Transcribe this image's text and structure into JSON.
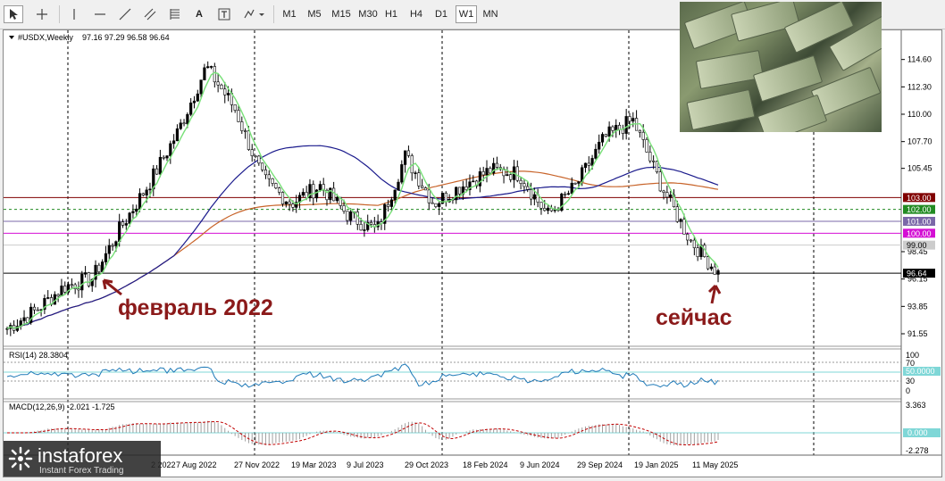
{
  "toolbar": {
    "tools": [
      "cursor-icon",
      "crosshair-icon",
      "vertical-line-icon",
      "horizontal-line-icon",
      "trend-line-icon",
      "fibonacci-icon",
      "text-label-icon",
      "text-tool-icon",
      "shapes-icon"
    ],
    "text_tool_label": "A",
    "timeframes": [
      "M1",
      "M5",
      "M15",
      "M30",
      "H1",
      "H4",
      "D1",
      "W1",
      "MN"
    ],
    "active_timeframe": "W1"
  },
  "header": {
    "symbol": "#USDX,Weekly",
    "ohlc": "97.16 97.29 96.58 96.64"
  },
  "annotations": {
    "feb2022": "февраль 2022",
    "now": "сейчас"
  },
  "price_axis": {
    "ticks": [
      "114.60",
      "112.30",
      "110.00",
      "107.70",
      "105.45",
      "98.45",
      "96.15",
      "93.85",
      "91.55"
    ]
  },
  "price_labels": [
    {
      "text": "103.00",
      "value": 103.0,
      "color": "#800000"
    },
    {
      "text": "102.00",
      "value": 102.0,
      "color": "#228b22"
    },
    {
      "text": "101.00",
      "value": 101.0,
      "color": "#7b68a8"
    },
    {
      "text": "100.00",
      "value": 100.0,
      "color": "#d40fd4"
    },
    {
      "text": "99.00",
      "value": 99.0,
      "color": "#cccccc"
    },
    {
      "text": "96.64",
      "value": 96.64,
      "color": "#000000"
    }
  ],
  "time_axis": {
    "labels": [
      "2 2022",
      "7 Aug 2022",
      "27 Nov 2022",
      "19 Mar 2023",
      "9 Jul 2023",
      "29 Oct 2023",
      "18 Feb 2024",
      "9 Jun 2024",
      "29 Sep 2024",
      "19 Jan 2025",
      "11 May 2025"
    ]
  },
  "rsi": {
    "label": "RSI(14) 28.3804",
    "levels": [
      "70",
      "50.0000",
      "30",
      "0"
    ],
    "top_label": "100"
  },
  "macd": {
    "label": "MACD(12,26,9) -2.021 -1.725",
    "levels": [
      "3.363",
      "0.000",
      "-2.278"
    ]
  },
  "watermark": {
    "brand": "instaforex",
    "tagline": "Instant Forex Trading"
  },
  "chart_data": {
    "type": "line",
    "title": "#USDX,Weekly",
    "ylim": [
      90.8,
      116.0
    ],
    "x": [
      "2021-06",
      "2021-09",
      "2021-12",
      "2022-02",
      "2022-04",
      "2022-06",
      "2022-08",
      "2022-09",
      "2022-11",
      "2023-01",
      "2023-03",
      "2023-05",
      "2023-07",
      "2023-08",
      "2023-10",
      "2023-12",
      "2024-02",
      "2024-04",
      "2024-06",
      "2024-08",
      "2024-10",
      "2024-12",
      "2025-01",
      "2025-03",
      "2025-05",
      "2025-06"
    ],
    "series": [
      {
        "values": [
          92.0,
          93.5,
          95.5,
          96.2,
          100.5,
          104.2,
          108.5,
          114.0,
          110.5,
          104.5,
          102.5,
          104.0,
          101.5,
          100.2,
          106.5,
          102.5,
          104.0,
          105.3,
          105.0,
          101.5,
          104.0,
          108.0,
          109.5,
          104.0,
          99.5,
          96.64
        ]
      }
    ],
    "horizontal_levels": [
      103.0,
      102.0,
      101.0,
      100.0,
      99.0,
      96.64
    ],
    "rsi_last": 28.3804,
    "macd_last": [
      -2.021,
      -1.725
    ]
  }
}
